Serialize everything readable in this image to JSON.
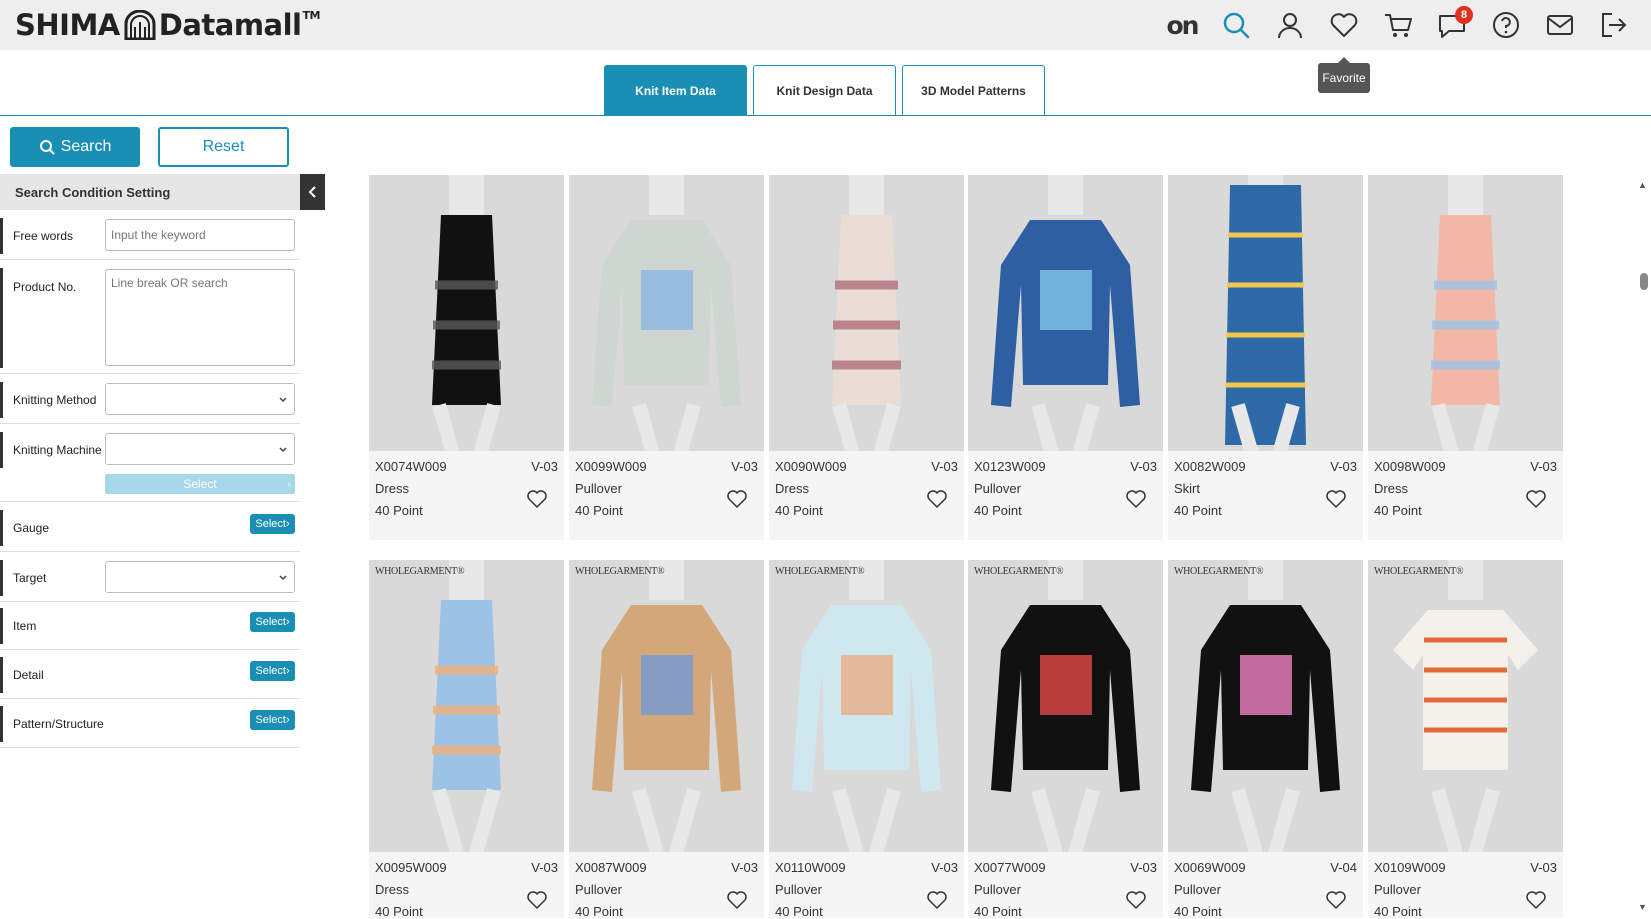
{
  "header": {
    "brand": "SHIMA",
    "brand_product": "Datamall",
    "brand_tm": "TM",
    "icons": [
      "on-logo",
      "search-icon",
      "user-icon",
      "heart-icon",
      "cart-icon",
      "chat-icon",
      "help-icon",
      "mail-icon",
      "logout-icon"
    ],
    "on_text": "on",
    "chat_badge": "8",
    "tooltip": "Favorite"
  },
  "tabs": [
    {
      "label": "Knit Item Data",
      "active": true
    },
    {
      "label": "Knit Design Data",
      "active": false
    },
    {
      "label": "3D Model Patterns",
      "active": false
    }
  ],
  "actions": {
    "search_label": "Search",
    "reset_label": "Reset"
  },
  "conditions": {
    "title": "Search Condition Setting",
    "free_words_label": "Free words",
    "free_words_placeholder": "Input the keyword",
    "product_no_label": "Product No.",
    "product_no_placeholder": "Line break OR search",
    "knitting_method_label": "Knitting Method",
    "knitting_machine_label": "Knitting Machine",
    "machine_select_label": "Select",
    "gauge_label": "Gauge",
    "target_label": "Target",
    "item_label": "Item",
    "detail_label": "Detail",
    "pattern_label": "Pattern/Structure",
    "select_button": "Select"
  },
  "colors": {
    "accent": "#1a8fb5",
    "badge": "#e0301e"
  },
  "products": [
    {
      "code": "X0074W009",
      "version": "V-03",
      "type": "Dress",
      "points": "40 Point",
      "wholegarment": false
    },
    {
      "code": "X0099W009",
      "version": "V-03",
      "type": "Pullover",
      "points": "40 Point",
      "wholegarment": false
    },
    {
      "code": "X0090W009",
      "version": "V-03",
      "type": "Dress",
      "points": "40 Point",
      "wholegarment": false
    },
    {
      "code": "X0123W009",
      "version": "V-03",
      "type": "Pullover",
      "points": "40 Point",
      "wholegarment": false
    },
    {
      "code": "X0082W009",
      "version": "V-03",
      "type": "Skirt",
      "points": "40 Point",
      "wholegarment": false
    },
    {
      "code": "X0098W009",
      "version": "V-03",
      "type": "Dress",
      "points": "40 Point",
      "wholegarment": false
    },
    {
      "code": "X0095W009",
      "version": "V-03",
      "type": "Dress",
      "points": "40 Point",
      "wholegarment": true
    },
    {
      "code": "X0087W009",
      "version": "V-03",
      "type": "Pullover",
      "points": "40 Point",
      "wholegarment": true
    },
    {
      "code": "X0110W009",
      "version": "V-03",
      "type": "Pullover",
      "points": "40 Point",
      "wholegarment": true
    },
    {
      "code": "X0077W009",
      "version": "V-03",
      "type": "Pullover",
      "points": "40 Point",
      "wholegarment": true
    },
    {
      "code": "X0069W009",
      "version": "V-04",
      "type": "Pullover",
      "points": "40 Point",
      "wholegarment": true
    },
    {
      "code": "X0109W009",
      "version": "V-03",
      "type": "Pullover",
      "points": "40 Point",
      "wholegarment": true
    }
  ],
  "wholegarment_label": "WHOLEGARMENT®"
}
